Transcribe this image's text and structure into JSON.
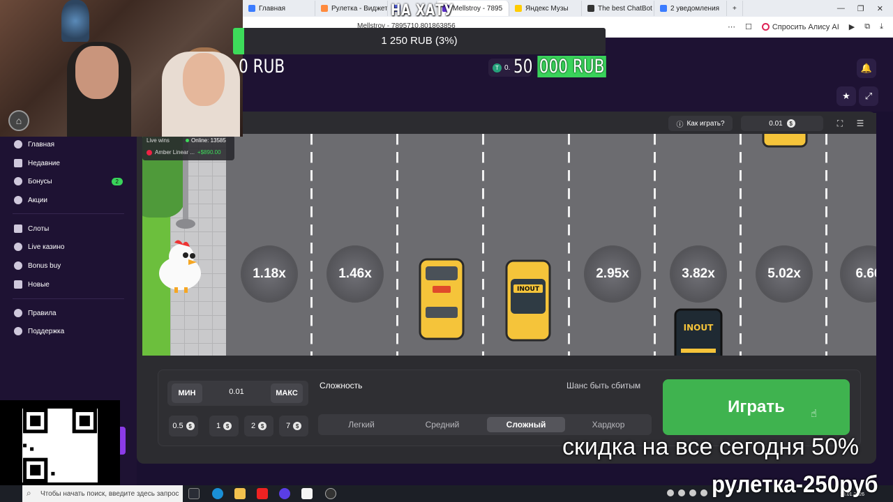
{
  "browser": {
    "tabs": [
      {
        "label": "Главная",
        "color": "#3b7cff",
        "active": false
      },
      {
        "label": "Рулетка - Виджет",
        "color": "#ff8a3d",
        "active": false
      },
      {
        "label": "2 ",
        "color": "#5a6bff",
        "active": false
      },
      {
        "label": "Mellstroy - 7895",
        "color": "#5b2ec9",
        "active": true
      },
      {
        "label": "Яндекс Музы",
        "color": "#ffcc00",
        "active": false
      },
      {
        "label": "The best ChatBot",
        "color": "#333333",
        "active": false
      },
      {
        "label": "2 уведомления",
        "color": "#3b7cff",
        "active": false
      }
    ],
    "address_title": "Mellstroy - 7895710.801863856",
    "alice_label": "Спросить Алису AI"
  },
  "stream": {
    "overlay_title": "НА ХАТУ",
    "progress_text": "1 250 RUB (3%)",
    "progress_percent": 3,
    "rub_left": "0 RUB",
    "rub_right_prefix": "50 ",
    "rub_right_highlight": "000 RUB",
    "tether_value": "0."
  },
  "sidebar": {
    "items": [
      {
        "label": "Главная",
        "badge": ""
      },
      {
        "label": "Недавние",
        "badge": ""
      },
      {
        "label": "Бонусы",
        "badge": "2"
      },
      {
        "label": "Акции",
        "badge": ""
      },
      {
        "label": "Слоты",
        "badge": ""
      },
      {
        "label": "Live казино",
        "badge": ""
      },
      {
        "label": "Bonus buy",
        "badge": ""
      },
      {
        "label": "Новые",
        "badge": ""
      },
      {
        "label": "Правила",
        "badge": ""
      },
      {
        "label": "Поддержка",
        "badge": ""
      }
    ]
  },
  "game": {
    "how_to_play": "Как играть?",
    "balance": "0.01",
    "live_wins_label": "Live wins",
    "online_label": "Online: 13585",
    "winner_name": "Amber Linear ...",
    "winner_amount": "+$890.00",
    "multipliers": [
      "1.18x",
      "1.46x",
      "2.95x",
      "3.82x",
      "5.02x",
      "6.66"
    ],
    "taxi_sign": "INOUT"
  },
  "bet_panel": {
    "min_label": "МИН",
    "bet_value": "0.01",
    "max_label": "МАКС",
    "quick_bets": [
      "0.5",
      "1",
      "2",
      "7"
    ],
    "difficulty_label": "Сложность",
    "chance_label": "Шанс быть сбитым",
    "difficulty_options": [
      "Легкий",
      "Средний",
      "Сложный",
      "Хардкор"
    ],
    "selected_difficulty": "Сложный",
    "play_label": "Играть"
  },
  "promo": {
    "line1": "скидка на все сегодня 50%",
    "line2": "рулетка-250руб"
  },
  "taskbar": {
    "search_placeholder": "Чтобы начать поиск, введите здесь запрос",
    "clock": "19.01.2026"
  }
}
